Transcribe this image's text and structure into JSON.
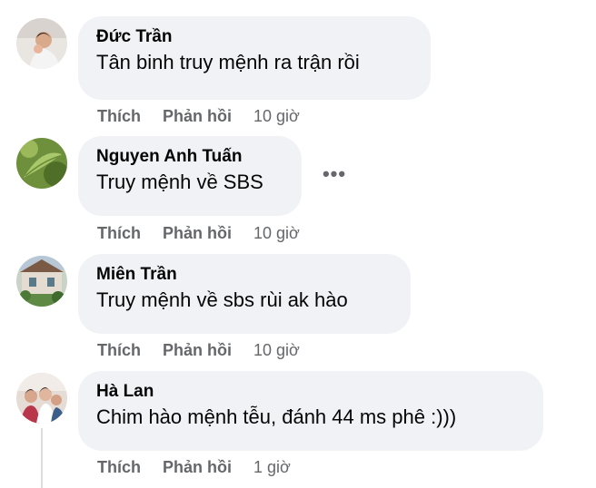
{
  "comments": [
    {
      "author": "Đức Trần",
      "text": "Tân binh truy mệnh ra trận rồi",
      "like_label": "Thích",
      "reply_label": "Phản hồi",
      "time": "10 giờ",
      "avatar_icon": "avatar-photo-person"
    },
    {
      "author": "Nguyen Anh Tuấn",
      "text": "Truy mệnh về SBS",
      "like_label": "Thích",
      "reply_label": "Phản hồi",
      "time": "10 giờ",
      "more_label": "•••",
      "avatar_icon": "avatar-photo-leaf"
    },
    {
      "author": "Miên Trần",
      "text": "Truy mệnh về sbs rùi ak hào",
      "like_label": "Thích",
      "reply_label": "Phản hồi",
      "time": "10 giờ",
      "avatar_icon": "avatar-photo-house"
    },
    {
      "author": "Hà Lan",
      "text": "Chim hào mệnh tễu, đánh 44 ms phê :)))",
      "like_label": "Thích",
      "reply_label": "Phản hồi",
      "time": "1 giờ",
      "avatar_icon": "avatar-photo-group"
    }
  ],
  "colors": {
    "bubble": "#f0f2f5",
    "name": "#050505",
    "meta": "#65676b"
  }
}
